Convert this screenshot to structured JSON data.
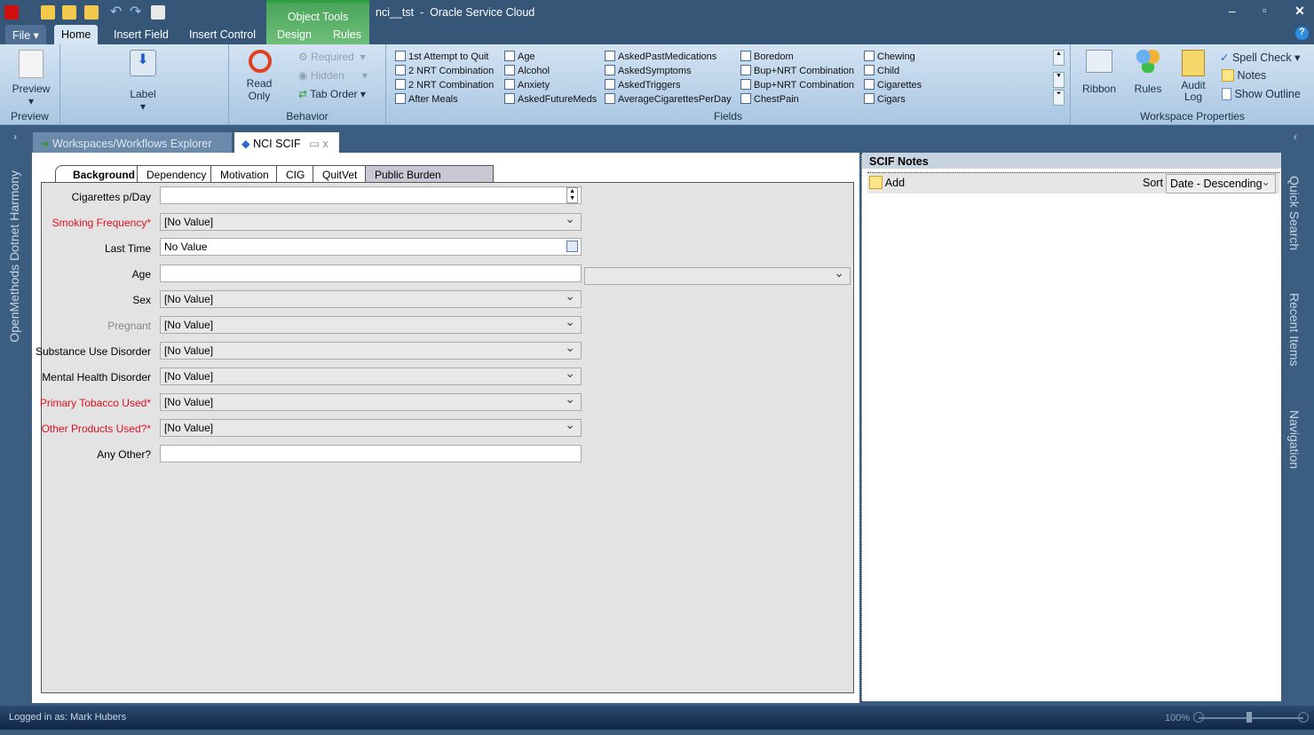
{
  "window": {
    "title": "nci__tst  -  Oracle Service Cloud",
    "contextual_group": "Object Tools"
  },
  "ribbon_tabs": [
    "File",
    "Home",
    "Insert Field",
    "Insert Control",
    "Design",
    "Rules"
  ],
  "ribbon": {
    "preview": {
      "button": "Preview",
      "group": "Preview"
    },
    "label": {
      "button": "Label"
    },
    "behavior": {
      "read_only": "Read Only",
      "required": "Required",
      "hidden": "Hidden",
      "tab_order": "Tab Order",
      "group": "Behavior"
    },
    "fields": {
      "group": "Fields",
      "columns": [
        [
          "1st Attempt to Quit",
          "2 NRT Combination",
          "2 NRT Combination",
          "After Meals"
        ],
        [
          "Age",
          "Alcohol",
          "Anxiety",
          "AskedFutureMeds"
        ],
        [
          "AskedPastMedications",
          "AskedSymptoms",
          "AskedTriggers",
          "AverageCigarettesPerDay"
        ],
        [
          "Boredom",
          "Bup+NRT Combination",
          "Bup+NRT Combination",
          "ChestPain"
        ],
        [
          "Chewing",
          "Child",
          "Cigarettes",
          "Cigars"
        ]
      ]
    },
    "workspace": {
      "ribbon": "Ribbon",
      "rules": "Rules",
      "audit_log": "Audit Log",
      "spell_check": "Spell Check",
      "notes": "Notes",
      "show_outline": "Show Outline",
      "group": "Workspace Properties"
    }
  },
  "side_left": "OpenMethods Dotnet Harmony",
  "side_right": [
    "Quick Search",
    "Recent Items",
    "Navigation"
  ],
  "doc_tabs": [
    "Workspaces/Workflows Explorer",
    "NCI SCIF"
  ],
  "form_tabs": [
    "Background",
    "Dependency",
    "Motivation",
    "CIG",
    "QuitVet",
    "Public Burden Statement"
  ],
  "form": [
    {
      "label": "Cigarettes p/Day",
      "value": ""
    },
    {
      "label": "Smoking Frequency*",
      "value": "[No Value]"
    },
    {
      "label": "Last Time",
      "value": "No Value"
    },
    {
      "label": "Age",
      "value": ""
    },
    {
      "label": "Sex",
      "value": "[No Value]"
    },
    {
      "label": "Pregnant",
      "value": "[No Value]"
    },
    {
      "label": "Substance Use Disorder",
      "value": "[No Value]"
    },
    {
      "label": "Mental Health Disorder",
      "value": "[No Value]"
    },
    {
      "label": "Primary Tobacco Used*",
      "value": "[No Value]"
    },
    {
      "label": "Other Products Used?*",
      "value": "[No Value]"
    },
    {
      "label": "Any Other?",
      "value": ""
    }
  ],
  "notes": {
    "title": "SCIF Notes",
    "add": "Add",
    "sort_label": "Sort",
    "sort_value": "Date - Descending"
  },
  "status": {
    "user": "Logged in as: Mark Hubers",
    "zoom": "100%"
  }
}
